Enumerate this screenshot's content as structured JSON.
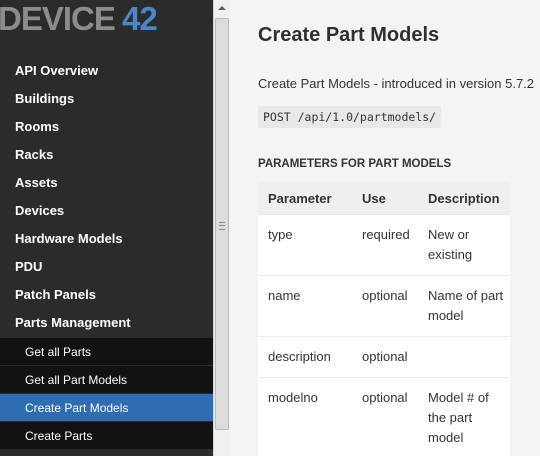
{
  "sidebar": {
    "logo_text": "DEVICE42",
    "items": [
      {
        "label": "API Overview"
      },
      {
        "label": "Buildings"
      },
      {
        "label": "Rooms"
      },
      {
        "label": "Racks"
      },
      {
        "label": "Assets"
      },
      {
        "label": "Devices"
      },
      {
        "label": "Hardware Models"
      },
      {
        "label": "PDU"
      },
      {
        "label": "Patch Panels"
      },
      {
        "label": "Parts Management"
      }
    ],
    "sub_items": [
      {
        "label": "Get all Parts"
      },
      {
        "label": "Get all Part Models"
      },
      {
        "label": "Create Part Models",
        "active": true
      },
      {
        "label": "Create Parts"
      }
    ]
  },
  "main": {
    "title": "Create Part Models",
    "intro": "Create Part Models - introduced in version 5.7.2",
    "endpoint": "POST /api/1.0/partmodels/",
    "section_heading": "PARAMETERS FOR PART MODELS",
    "table": {
      "headers": [
        "Parameter",
        "Use",
        "Description"
      ],
      "rows": [
        {
          "parameter": "type",
          "use": "required",
          "description": "New or existing"
        },
        {
          "parameter": "name",
          "use": "optional",
          "description": "Name of part model"
        },
        {
          "parameter": "description",
          "use": "optional",
          "description": ""
        },
        {
          "parameter": "modelno",
          "use": "optional",
          "description": "Model # of the part model"
        }
      ]
    }
  },
  "colors": {
    "sidebar_bg": "#2b2b2b",
    "submenu_bg": "#121212",
    "active_bg": "#2f6db3",
    "logo_blue": "#4a86c9"
  }
}
